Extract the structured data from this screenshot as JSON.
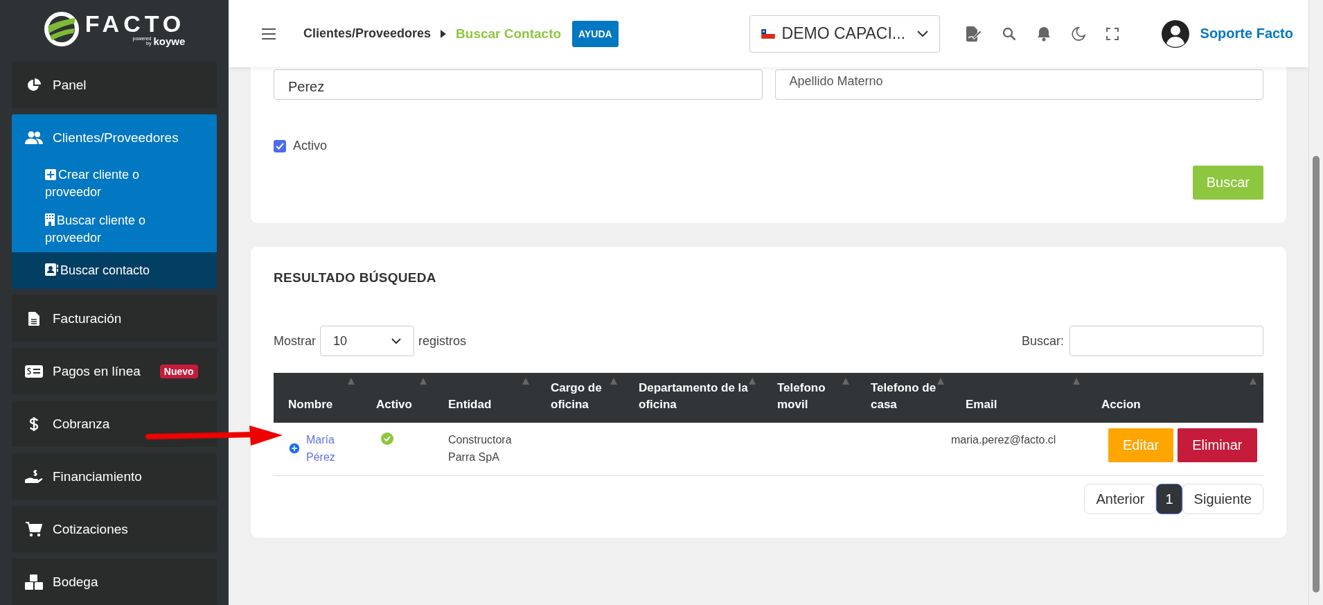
{
  "logo": {
    "brand": "FACTO",
    "powered": "powered",
    "by": "by",
    "partner": "koywe"
  },
  "sidebar": {
    "items": [
      {
        "label": "Panel",
        "selected": false
      },
      {
        "label": "Clientes/Proveedores",
        "selected": true,
        "expanded": true,
        "children": [
          {
            "label": "Crear cliente o proveedor",
            "selected": false
          },
          {
            "label": "Buscar cliente o proveedor",
            "selected": false
          },
          {
            "label": "Buscar contacto",
            "selected": true
          }
        ]
      },
      {
        "label": "Facturación",
        "selected": false
      },
      {
        "label": "Pagos en línea",
        "selected": false,
        "badge": "Nuevo"
      },
      {
        "label": "Cobranza",
        "selected": false
      },
      {
        "label": "Financiamiento",
        "selected": false
      },
      {
        "label": "Cotizaciones",
        "selected": false
      },
      {
        "label": "Bodega",
        "selected": false
      }
    ]
  },
  "header": {
    "breadcrumb": [
      "Clientes/Proveedores",
      "Buscar Contacto"
    ],
    "help": "AYUDA",
    "company": "DEMO CAPACI...",
    "user": "Soporte Facto"
  },
  "form": {
    "fields": [
      {
        "value": "Perez"
      },
      {
        "placeholder": "Apellido Materno"
      }
    ],
    "checkbox": {
      "label": "Activo",
      "checked": true
    },
    "button": "Buscar"
  },
  "results": {
    "title": "RESULTADO BÚSQUEDA",
    "length": {
      "before": "Mostrar",
      "value": "10",
      "after": "registros"
    },
    "search": {
      "label": "Buscar:"
    },
    "columns": [
      "Nombre",
      "Activo",
      "Entidad",
      "Cargo de oficina",
      "Departamento de la oficina",
      "Telefono movil",
      "Telefono de casa",
      "Email",
      "Accion"
    ],
    "rows": [
      {
        "name": "María Pérez",
        "active": true,
        "entity": "Constructora Parra SpA",
        "email": "maria.perez@facto.cl",
        "actions": [
          "Editar",
          "Eliminar"
        ]
      }
    ],
    "pagination": [
      {
        "label": "Anterior",
        "selected": false
      },
      {
        "label": "1",
        "selected": true
      },
      {
        "label": "Siguiente",
        "selected": false
      }
    ]
  }
}
